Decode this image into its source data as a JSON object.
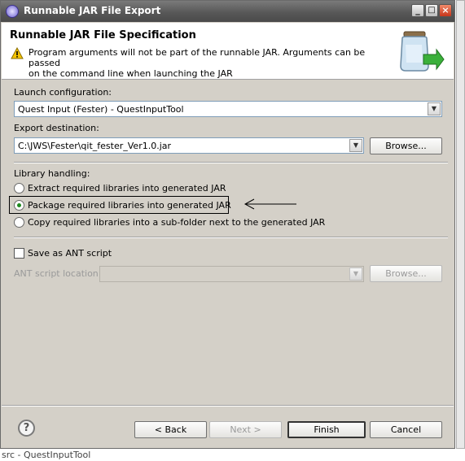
{
  "window": {
    "title": "Runnable JAR File Export",
    "minimize_label": "_",
    "maximize_label": "□",
    "close_label": "×"
  },
  "header": {
    "title": "Runnable JAR File Specification",
    "message_line1": "Program arguments will not be part of the runnable JAR. Arguments can be passed",
    "message_line2": "on the command line when launching the JAR"
  },
  "launch": {
    "label": "Launch configuration:",
    "value": "Quest Input (Fester) - QuestInputTool"
  },
  "export": {
    "label": "Export destination:",
    "value": "C:\\JWS\\Fester\\qit_fester_Ver1.0.jar",
    "browse_label": "Browse..."
  },
  "library": {
    "label": "Library handling:",
    "options": [
      {
        "label": "Extract required libraries into generated JAR",
        "selected": false
      },
      {
        "label": "Package required libraries into generated JAR",
        "selected": true
      },
      {
        "label": "Copy required libraries into a sub-folder next to the generated JAR",
        "selected": false
      }
    ]
  },
  "ant": {
    "checkbox_label": "Save as ANT script",
    "checked": false,
    "location_label": "ANT script location:",
    "location_value": "",
    "browse_label": "Browse..."
  },
  "footer": {
    "help_label": "?",
    "back_label": "< Back",
    "next_label": "Next >",
    "finish_label": "Finish",
    "cancel_label": "Cancel"
  },
  "background": {
    "status_text": "src - QuestInputTool"
  },
  "colors": {
    "titlebar": "#585858",
    "dialog_bg": "#d4d0c8",
    "combo_border": "#7f9db9",
    "radio_dot": "#1f8a1f"
  }
}
